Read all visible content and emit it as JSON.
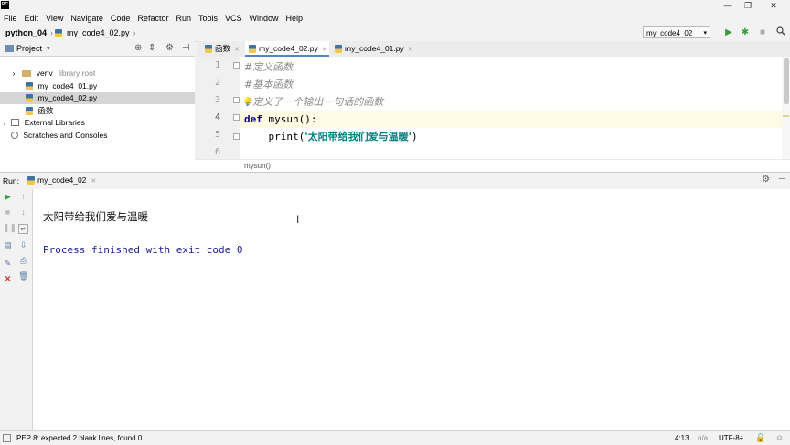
{
  "app": {
    "logo_text": "PC"
  },
  "window_controls": {
    "minimize": "—",
    "maximize": "❐",
    "close": "✕"
  },
  "menu": [
    "File",
    "Edit",
    "View",
    "Navigate",
    "Code",
    "Refactor",
    "Run",
    "Tools",
    "VCS",
    "Window",
    "Help"
  ],
  "navbar": {
    "project": "python_04",
    "file": "my_code4_02.py",
    "separator": "›"
  },
  "run_config": {
    "value": "my_code4_02",
    "arrow": "▾"
  },
  "project_panel": {
    "title": "Project",
    "arrow": "▾",
    "tree": [
      {
        "label": "venv",
        "suffix": "library root",
        "indent": 1,
        "icon": "folder-icon",
        "expander": "›"
      },
      {
        "label": "my_code4_01.py",
        "indent": 2,
        "icon": "python-file-icon"
      },
      {
        "label": "my_code4_02.py",
        "indent": 2,
        "icon": "python-file-icon",
        "selected": true
      },
      {
        "label": "函数",
        "indent": 2,
        "icon": "python-file-icon"
      },
      {
        "label": "External Libraries",
        "indent": 0,
        "icon": "library-icon",
        "expander": "›"
      },
      {
        "label": "Scratches and Consoles",
        "indent": 0,
        "icon": "scratches-icon"
      }
    ]
  },
  "editor_tabs": [
    {
      "label": "函数",
      "active": false
    },
    {
      "label": "my_code4_02.py",
      "active": true
    },
    {
      "label": "my_code4_01.py",
      "active": false
    }
  ],
  "code_lines": [
    {
      "num": "1",
      "segments": [
        {
          "t": "#定义函数",
          "c": "cmt"
        }
      ]
    },
    {
      "num": "2",
      "segments": [
        {
          "t": "#基本函数",
          "c": "cmt"
        }
      ]
    },
    {
      "num": "3",
      "segments": [
        {
          "t": "#定义了一个输出一句话的函数",
          "c": "cmt"
        }
      ]
    },
    {
      "num": "4",
      "segments": [
        {
          "t": "def",
          "c": "kw"
        },
        {
          "t": " mysun():",
          "c": ""
        }
      ],
      "current": true
    },
    {
      "num": "5",
      "segments": [
        {
          "t": "    print(",
          "c": ""
        },
        {
          "t": "'太阳带给我们爱与温暖'",
          "c": "str"
        },
        {
          "t": ")",
          "c": ""
        }
      ]
    },
    {
      "num": "6",
      "segments": []
    }
  ],
  "editor_breadcrumb": "mysun()",
  "run_panel": {
    "label": "Run:",
    "tab": "my_code4_02",
    "output": [
      "太阳带给我们爱与温暖",
      "",
      "Process finished with exit code 0"
    ]
  },
  "statusbar": {
    "message": "PEP 8: expected 2 blank lines, found 0",
    "position": "4:13",
    "separator": "n/a",
    "encoding": "UTF-8÷"
  },
  "colors": {
    "run_green": "#3c9b3c",
    "stop_red": "#d23a3a",
    "accent_blue": "#4a88c7",
    "keyword": "#000080",
    "string": "#008080",
    "console_text": "#1b1b8f"
  }
}
